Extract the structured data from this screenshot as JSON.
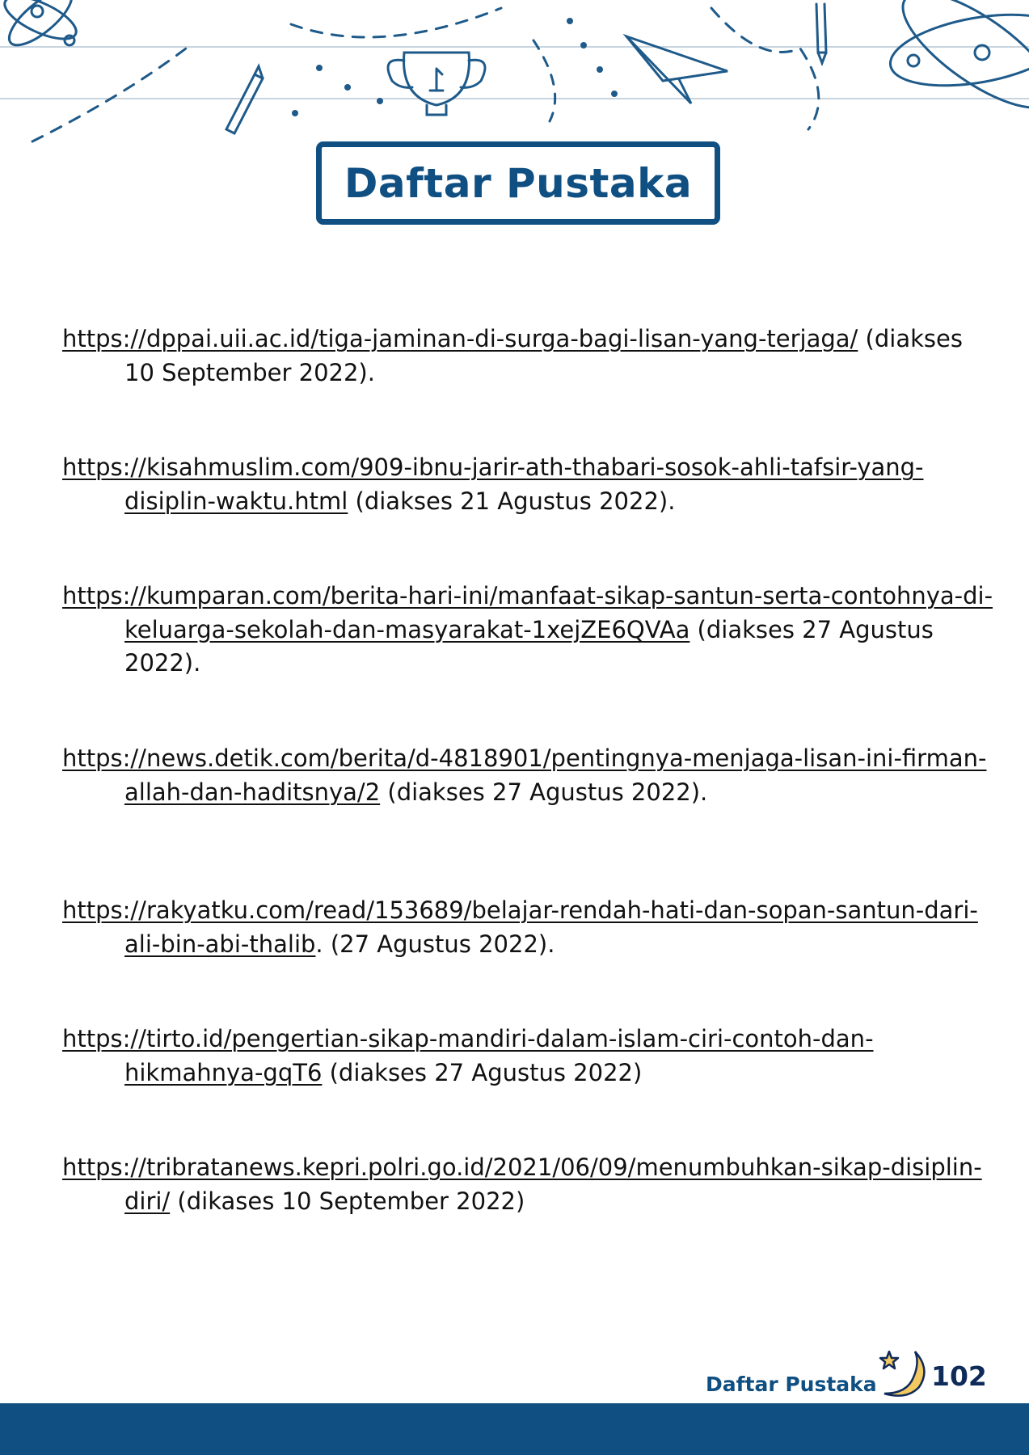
{
  "header": {
    "title": "Daftar Pustaka"
  },
  "references": [
    {
      "link": "https://dppai.uii.ac.id/tiga-jaminan-di-surga-bagi-lisan-yang-terjaga/",
      "note": " (diakses 10 September 2022)."
    },
    {
      "link": "https://kisahmuslim.com/909-ibnu-jarir-ath-thabari-sosok-ahli-tafsir-yang-disiplin-waktu.html",
      "note": " (diakses 21 Agustus 2022)."
    },
    {
      "link": "https://kumparan.com/berita-hari-ini/manfaat-sikap-santun-serta-contohnya-di-keluarga-sekolah-dan-masyarakat-1xejZE6QVAa",
      "note": " (diakses 27 Agustus 2022)."
    },
    {
      "link": "https://news.detik.com/berita/d-4818901/pentingnya-menjaga-lisan-ini-firman-allah-dan-haditsnya/2",
      "note": "  (diakses  27  Agustus 2022)."
    },
    {
      "link": "https://rakyatku.com/read/153689/belajar-rendah-hati-dan-sopan-santun-dari-ali-bin-abi-thalib",
      "note": ". (27 Agustus 2022)."
    },
    {
      "link": "https://tirto.id/pengertian-sikap-mandiri-dalam-islam-ciri-contoh-dan-hikmahnya-gqT6",
      "note": " (diakses 27 Agustus 2022)"
    },
    {
      "link": "https://tribratanews.kepri.polri.go.id/2021/06/09/menumbuhkan-sikap-disiplin-diri/",
      "note": " (dikases 10 September 2022)"
    }
  ],
  "footer": {
    "label": "Daftar Pustaka",
    "page_number": "102"
  },
  "colors": {
    "brand_blue": "#0f4f82",
    "text": "#111111",
    "moon_yellow": "#f3c960"
  },
  "icons": [
    "doodle-header-illustration",
    "moon-star-icon"
  ]
}
